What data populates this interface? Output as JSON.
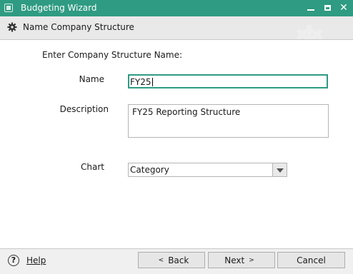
{
  "window": {
    "title": "Budgeting Wizard",
    "controls": {
      "minimize": "",
      "maximize": "",
      "close": "✕"
    },
    "accent": "#2f9b82"
  },
  "header": {
    "title": "Name Company Structure",
    "icon": "gear-icon"
  },
  "form": {
    "prompt": "Enter Company Structure Name:",
    "name_label": "Name",
    "name_value": "FY25",
    "description_label": "Description",
    "description_value": "FY25 Reporting Structure",
    "chart_label": "Chart",
    "chart_value": "Category"
  },
  "footer": {
    "help_label": "Help",
    "help_icon": "?",
    "back_label": "Back",
    "back_arrow": "<",
    "next_label": "Next",
    "next_arrow": ">",
    "cancel_label": "Cancel"
  }
}
